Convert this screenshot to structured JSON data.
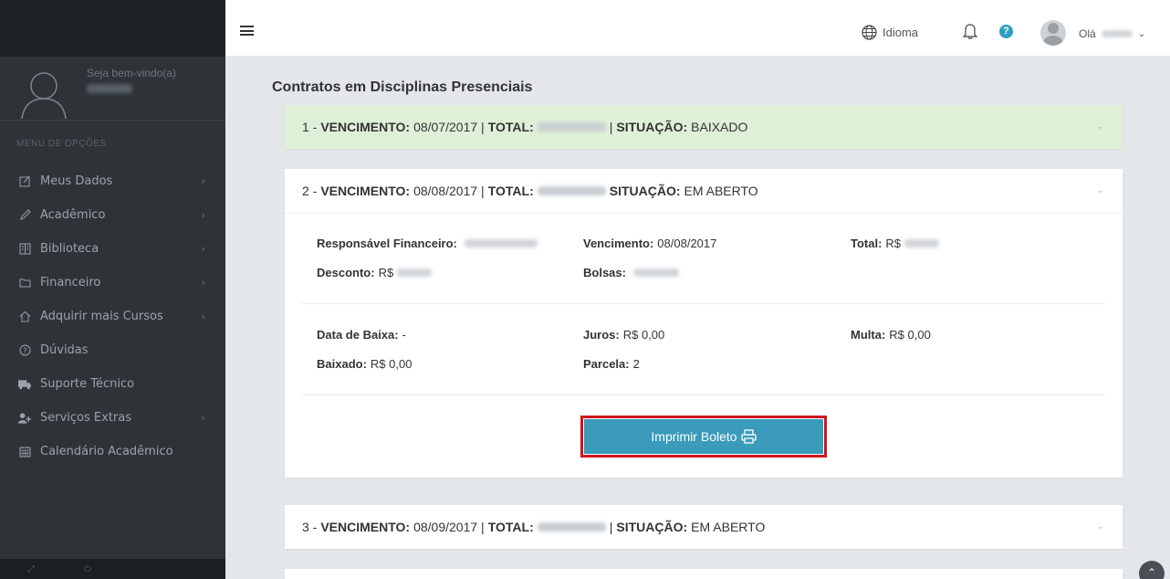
{
  "sidebar": {
    "welcome": "Seja bem-vindo(a)",
    "menu_title": "MENU DE OPÇÕES",
    "items": [
      {
        "label": "Meus Dados",
        "icon": "edit-icon",
        "has_children": true
      },
      {
        "label": "Acadêmico",
        "icon": "pencil-icon",
        "has_children": true
      },
      {
        "label": "Biblioteca",
        "icon": "book-icon",
        "has_children": true
      },
      {
        "label": "Financeiro",
        "icon": "folder-icon",
        "has_children": true
      },
      {
        "label": "Adquirir mais Cursos",
        "icon": "home-icon",
        "has_children": true
      },
      {
        "label": "Dúvidas",
        "icon": "question-circle-icon",
        "has_children": false
      },
      {
        "label": "Suporte Técnico",
        "icon": "ambulance-icon",
        "has_children": false
      },
      {
        "label": "Serviços Extras",
        "icon": "user-plus-icon",
        "has_children": true
      },
      {
        "label": "Calendário Acadêmico",
        "icon": "calendar-icon",
        "has_children": false
      }
    ]
  },
  "header": {
    "language_label": "Idioma",
    "greeting": "Olá"
  },
  "main": {
    "title": "Contratos em Disciplinas Presenciais",
    "labels": {
      "vencimento": "VENCIMENTO:",
      "total": "TOTAL:",
      "situacao": "SITUAÇÃO:"
    },
    "contracts": [
      {
        "number": "1 -",
        "due_date": "08/07/2017 |",
        "status": "BAIXADO",
        "expanded": false
      },
      {
        "number": "2 -",
        "due_date": "08/08/2017 |",
        "status": "EM ABERTO",
        "expanded": true
      },
      {
        "number": "3 -",
        "due_date": "08/09/2017 |",
        "status": "EM ABERTO",
        "expanded": false
      }
    ],
    "details": {
      "responsavel_label": "Responsável Financeiro:",
      "vencimento_label": "Vencimento:",
      "vencimento_value": "08/08/2017",
      "total_label": "Total:",
      "total_value": "R$",
      "desconto_label": "Desconto:",
      "desconto_value": "R$",
      "bolsas_label": "Bolsas:",
      "data_baixa_label": "Data de Baixa:",
      "data_baixa_value": "-",
      "juros_label": "Juros:",
      "juros_value": "R$ 0,00",
      "multa_label": "Multa:",
      "multa_value": "R$ 0,00",
      "baixado_label": "Baixado:",
      "baixado_value": "R$ 0,00",
      "parcela_label": "Parcela:",
      "parcela_value": "2"
    },
    "print_button": "Imprimir Boleto"
  },
  "colors": {
    "sidebar_bg": "#2f3338",
    "paid_bg": "#dff0d8",
    "button_bg": "#3a9bba",
    "highlight_border": "#d0141c"
  }
}
